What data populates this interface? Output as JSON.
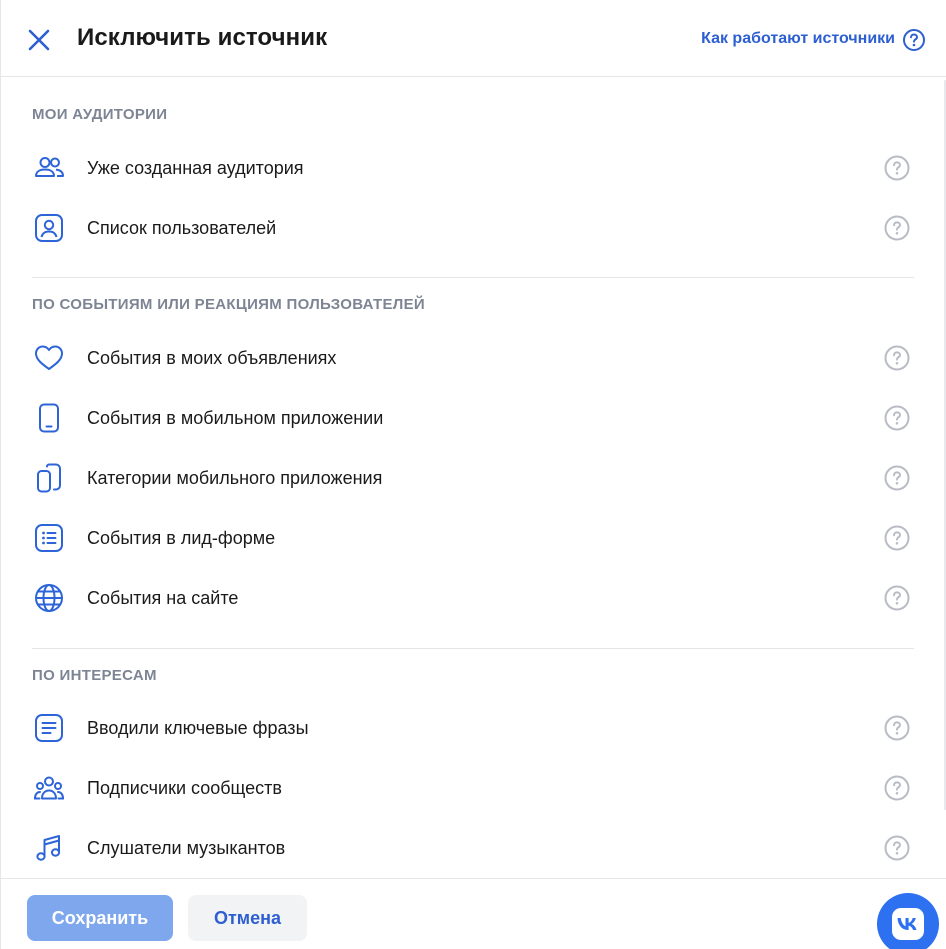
{
  "header": {
    "title": "Исключить источник",
    "help_link": "Как работают источники",
    "close_icon": "close-icon",
    "help_icon": "question-circle-icon"
  },
  "sections": [
    {
      "title": "МОИ АУДИТОРИИ",
      "items": [
        {
          "label": "Уже созданная аудитория",
          "icon": "users-icon"
        },
        {
          "label": "Список пользователей",
          "icon": "user-card-icon"
        }
      ]
    },
    {
      "title": "ПО СОБЫТИЯМ ИЛИ РЕАКЦИЯМ ПОЛЬЗОВАТЕЛЕЙ",
      "items": [
        {
          "label": "События в моих объявлениях",
          "icon": "heart-icon"
        },
        {
          "label": "События в мобильном приложении",
          "icon": "phone-icon"
        },
        {
          "label": "Категории мобильного приложения",
          "icon": "phones-icon"
        },
        {
          "label": "События в лид-форме",
          "icon": "list-icon"
        },
        {
          "label": "События на сайте",
          "icon": "globe-icon"
        }
      ]
    },
    {
      "title": "ПО ИНТЕРЕСАМ",
      "items": [
        {
          "label": "Вводили ключевые фразы",
          "icon": "text-doc-icon"
        },
        {
          "label": "Подписчики сообществ",
          "icon": "community-icon"
        },
        {
          "label": "Слушатели музыкантов",
          "icon": "music-icon"
        }
      ]
    }
  ],
  "footer": {
    "save_label": "Сохранить",
    "cancel_label": "Отмена"
  },
  "colors": {
    "accent": "#2d5fd0",
    "icon_blue": "#2d65d8",
    "muted": "#7d8594",
    "save_disabled": "#7ea7ee",
    "vk_badge": "#2d71f0"
  }
}
